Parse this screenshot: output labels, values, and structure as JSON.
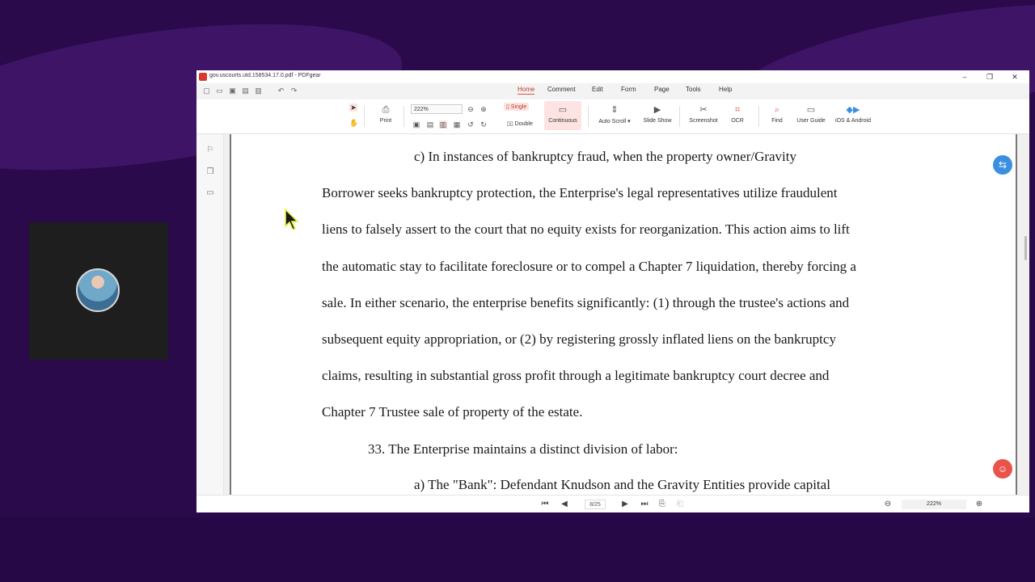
{
  "window": {
    "title": "gov.uscourts.utd.158534.17.0.pdf - PDFgear",
    "controls": [
      "–",
      "❐",
      "✕"
    ]
  },
  "menu": {
    "tabs": [
      "Home",
      "Comment",
      "Edit",
      "Form",
      "Page",
      "Tools",
      "Help"
    ],
    "active": "Home"
  },
  "ribbon": {
    "print": "Print",
    "zoom_value": "222%",
    "single": "Single",
    "double": "Double",
    "continuous": "Continuous",
    "auto_scroll": "Auto Scroll",
    "slide_show": "Slide Show",
    "screenshot": "Screenshot",
    "ocr": "OCR",
    "find": "Find",
    "user_guide": "User Guide",
    "ios_android": "iOS & Android"
  },
  "document": {
    "lines": [
      "c)          In instances of bankruptcy fraud, when the property owner/Gravity",
      "Borrower seeks bankruptcy protection, the Enterprise's legal representatives utilize fraudulent",
      "liens to falsely assert to the court that no equity exists for reorganization. This action aims to lift",
      "the automatic stay to facilitate foreclosure or to compel a Chapter 7 liquidation, thereby forcing a",
      "sale. In either scenario, the enterprise benefits significantly: (1) through the trustee's actions and",
      "subsequent equity appropriation, or (2) by registering grossly inflated liens on the bankruptcy",
      "claims, resulting in substantial gross profit through a legitimate bankruptcy court decree and",
      "Chapter 7 Trustee sale of property of the estate.",
      "33.          The Enterprise maintains a distinct division of labor:",
      "a)          The \"Bank\": Defendant Knudson and the Gravity Entities provide capital"
    ]
  },
  "status": {
    "page_display": "8/25",
    "zoom_display": "222%"
  },
  "colors": {
    "background": "#2a0a4a",
    "accent": "#d9534f",
    "translate_button": "#3a8fe0",
    "ai_button": "#e8534a"
  }
}
